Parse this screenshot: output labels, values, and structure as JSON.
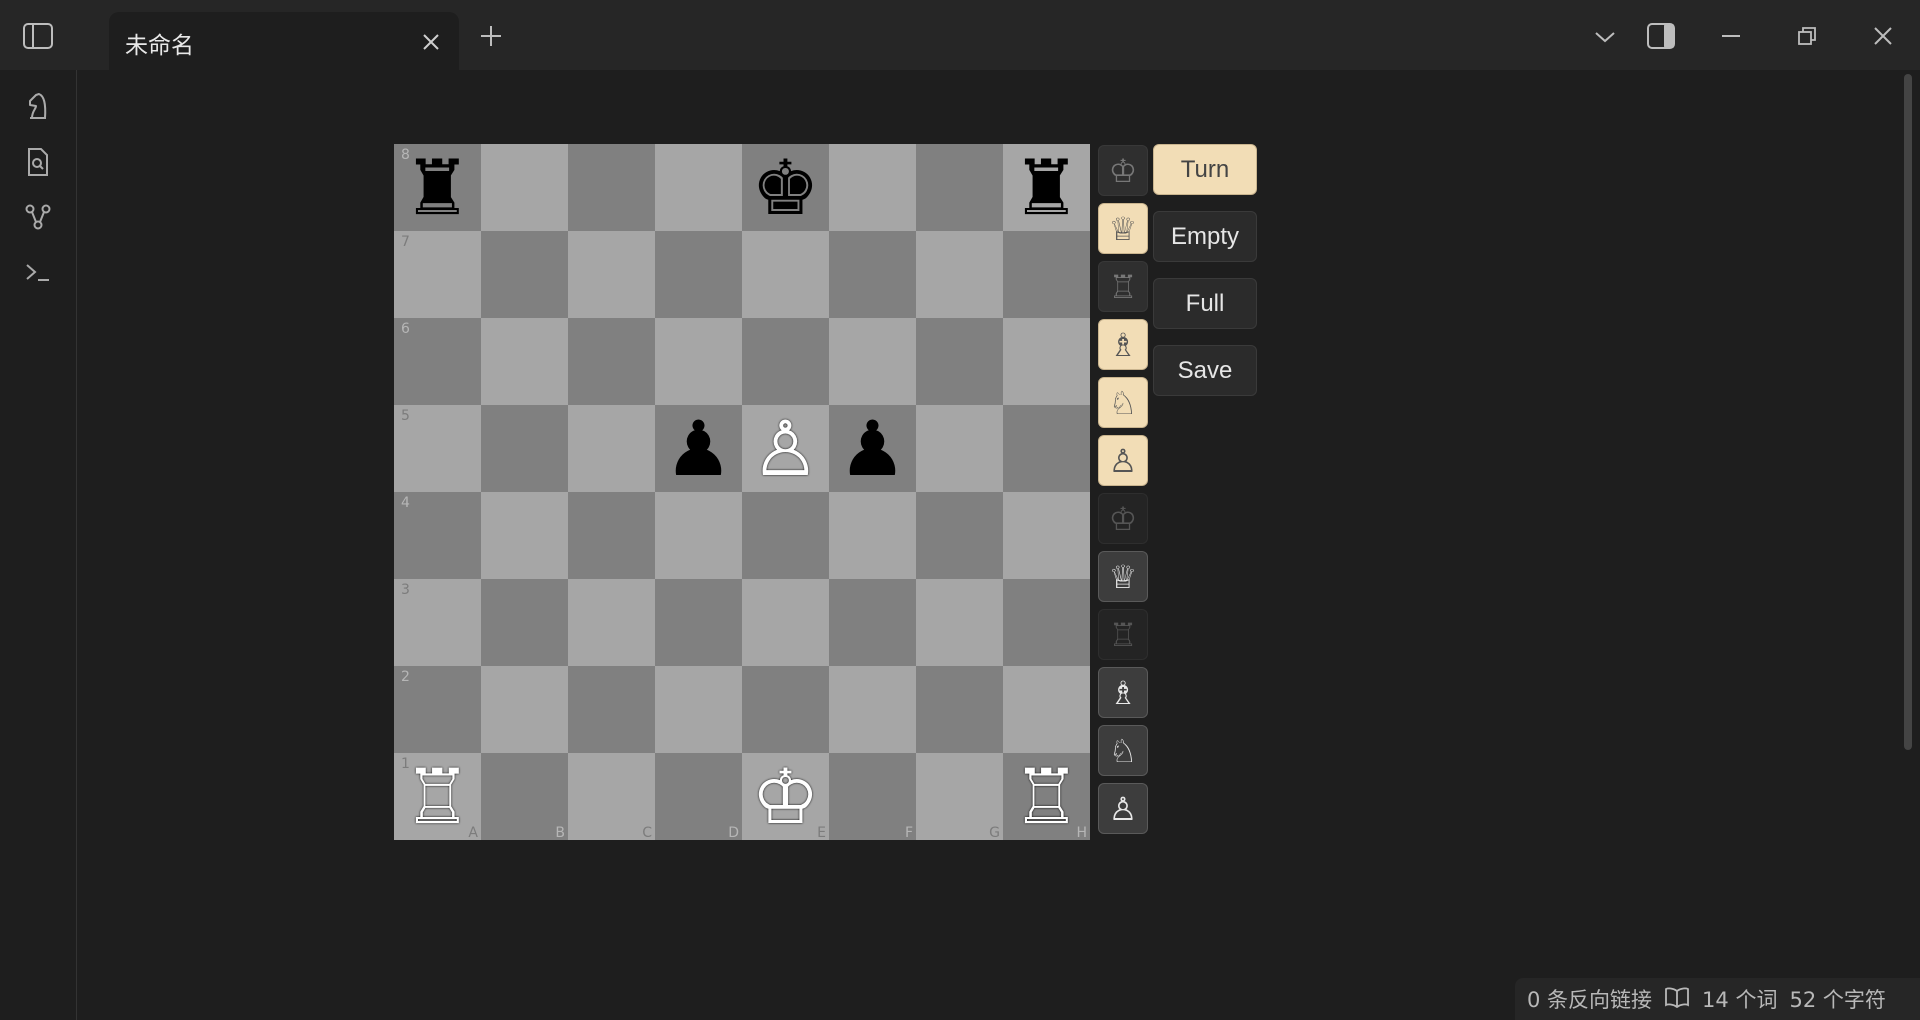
{
  "tab": {
    "title": "未命名"
  },
  "board": {
    "squares": [
      [
        "♜",
        "",
        "",
        "",
        "♚",
        "",
        "",
        "♜"
      ],
      [
        "",
        "",
        "",
        "",
        "",
        "",
        "",
        ""
      ],
      [
        "",
        "",
        "",
        "",
        "",
        "",
        "",
        ""
      ],
      [
        "",
        "",
        "",
        "♟",
        "♙",
        "♟",
        "",
        ""
      ],
      [
        "",
        "",
        "",
        "",
        "",
        "",
        "",
        ""
      ],
      [
        "",
        "",
        "",
        "",
        "",
        "",
        "",
        ""
      ],
      [
        "",
        "",
        "",
        "",
        "",
        "",
        "",
        ""
      ],
      [
        "♖",
        "",
        "",
        "",
        "♔",
        "",
        "",
        "♖"
      ]
    ],
    "ranks": [
      "8",
      "7",
      "6",
      "5",
      "4",
      "3",
      "2",
      "1"
    ],
    "files": [
      "A",
      "B",
      "C",
      "D",
      "E",
      "F",
      "G",
      "H"
    ]
  },
  "palette": [
    {
      "glyph": "♔",
      "name": "king",
      "set": "w",
      "active": false
    },
    {
      "glyph": "♕",
      "name": "queen",
      "set": "w",
      "active": true
    },
    {
      "glyph": "♖",
      "name": "rook",
      "set": "w",
      "active": false
    },
    {
      "glyph": "♗",
      "name": "bishop",
      "set": "w",
      "active": true
    },
    {
      "glyph": "♘",
      "name": "knight",
      "set": "w",
      "active": true
    },
    {
      "glyph": "♙",
      "name": "pawn",
      "set": "w",
      "active": true
    },
    {
      "glyph": "♔",
      "name": "king",
      "set": "b",
      "active": false
    },
    {
      "glyph": "♕",
      "name": "queen",
      "set": "b",
      "active": true
    },
    {
      "glyph": "♖",
      "name": "rook",
      "set": "b",
      "active": false
    },
    {
      "glyph": "♗",
      "name": "bishop",
      "set": "b",
      "active": true
    },
    {
      "glyph": "♘",
      "name": "knight",
      "set": "b",
      "active": true
    },
    {
      "glyph": "♙",
      "name": "pawn",
      "set": "b",
      "active": true
    }
  ],
  "controls": {
    "turn": "Turn",
    "empty": "Empty",
    "full": "Full",
    "save": "Save"
  },
  "status": {
    "backlinks": "0 条反向链接",
    "words": "14 个词",
    "chars": "52 个字符"
  },
  "colors": {
    "accent": "#f2ddb6",
    "light_square": "#a6a6a6",
    "dark_square": "#808080"
  },
  "icons": {
    "ribbon": [
      "chess-knight-icon",
      "file-search-icon",
      "graph-icon",
      "terminal-icon"
    ],
    "titlebar": [
      "sidebar-toggle-icon",
      "close-icon",
      "plus-icon",
      "chevron-down-icon",
      "right-panel-icon",
      "minimize-icon",
      "restore-icon",
      "close-icon"
    ]
  }
}
